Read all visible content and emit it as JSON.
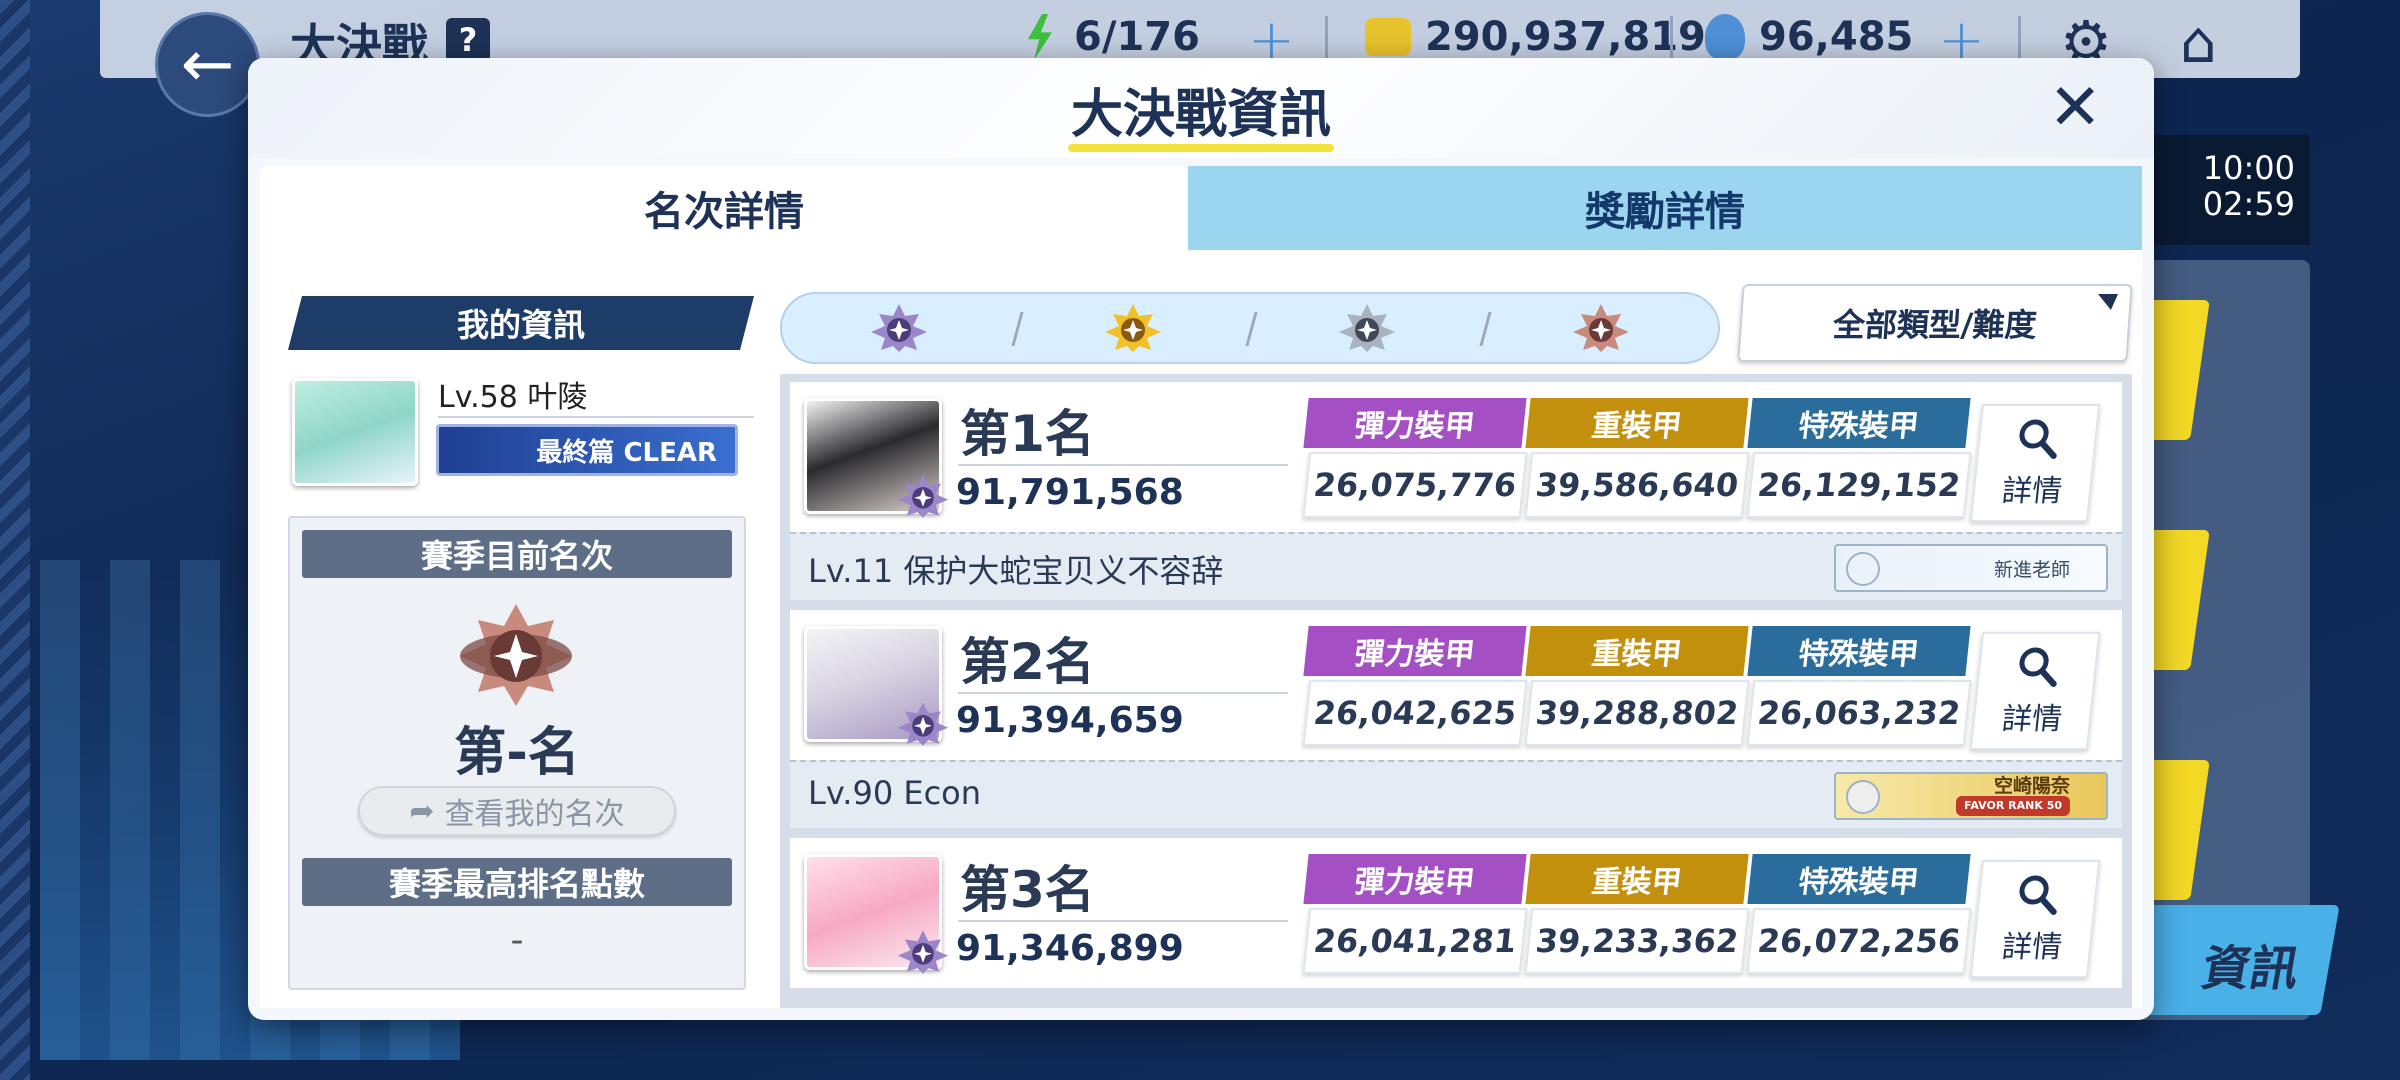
{
  "topbar": {
    "title": "大決戰",
    "help": "?",
    "ap": "6/176",
    "credits": "290,937,819",
    "gems": "96,485",
    "back_icon": "arrow-left-icon",
    "settings_icon": "gear-icon",
    "home_icon": "home-icon"
  },
  "background": {
    "time_line1": "10:00",
    "time_line2": "02:59",
    "info_button": "資訊"
  },
  "modal": {
    "title": "大決戰資訊",
    "close_icon": "close-icon",
    "tabs": [
      {
        "label": "名次詳情",
        "active": true
      },
      {
        "label": "獎勵詳情",
        "active": false
      }
    ]
  },
  "my_info": {
    "header": "我的資訊",
    "level_name": "Lv.58 叶陵",
    "clear_plate": "最終篇 CLEAR",
    "season_rank_header": "賽季目前名次",
    "season_rank": "第-名",
    "view_my_rank": "查看我的名次",
    "best_points_header": "賽季最高排名點數",
    "best_points": "-"
  },
  "filters": {
    "emblems": [
      "platinum-emblem-icon",
      "gold-emblem-icon",
      "silver-emblem-icon",
      "bronze-emblem-icon"
    ],
    "dropdown": "全部類型/難度"
  },
  "armor_labels": {
    "light": "彈力裝甲",
    "heavy": "重裝甲",
    "special": "特殊裝甲"
  },
  "detail_label": "詳情",
  "rankings": [
    {
      "rank": "第1名",
      "score": "91,791,568",
      "light": "26,075,776",
      "heavy": "39,586,640",
      "special": "26,129,152",
      "teacher": "Lv.11 保护大蛇宝贝义不容辞",
      "title_plate": "新進老師",
      "plate_style": "new"
    },
    {
      "rank": "第2名",
      "score": "91,394,659",
      "light": "26,042,625",
      "heavy": "39,288,802",
      "special": "26,063,232",
      "teacher": "Lv.90  Econ",
      "title_plate": "空崎陽奈",
      "title_plate_sub": "FAVOR RANK 50",
      "plate_style": "favor"
    },
    {
      "rank": "第3名",
      "score": "91,346,899",
      "light": "26,041,281",
      "heavy": "39,233,362",
      "special": "26,072,256"
    }
  ],
  "colors": {
    "light_armor": "#a54fc5",
    "heavy_armor": "#c3900e",
    "special_armor": "#2a6d9c",
    "navy": "#1d3256",
    "tab_inactive": "#9cd5ee",
    "title_underline": "#f3e23a"
  }
}
